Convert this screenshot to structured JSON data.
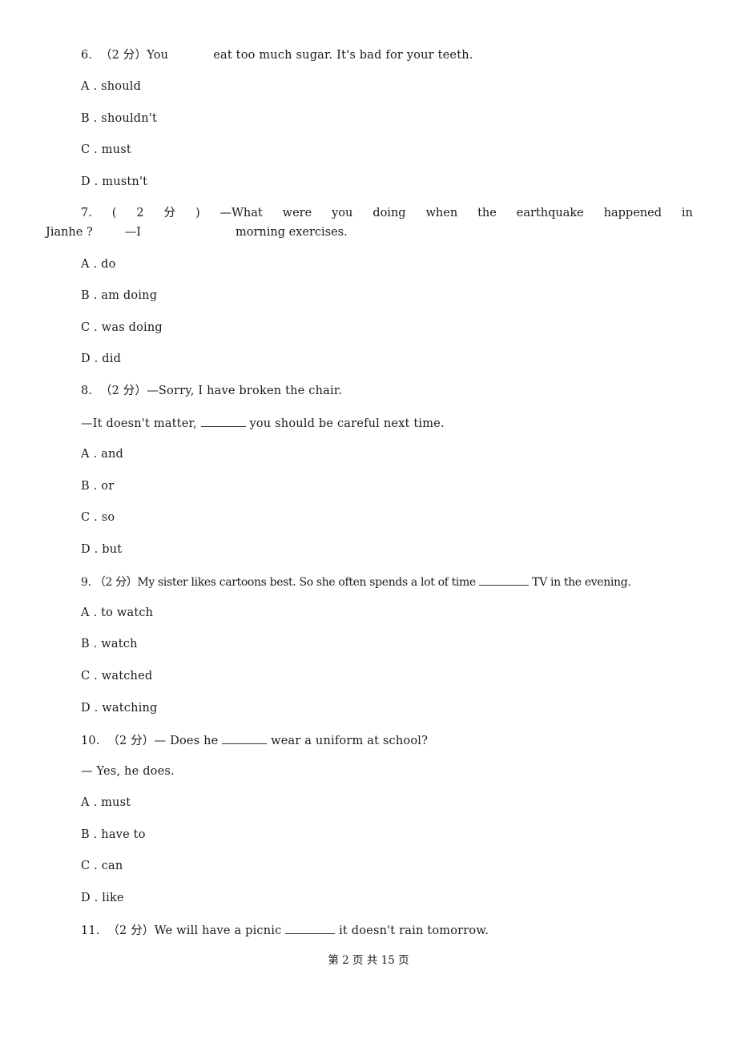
{
  "page": {
    "footer": "第 2 页 共 15 页"
  },
  "questions": [
    {
      "number": "6.",
      "score": "（2 分）",
      "stem_parts": [
        "You",
        "eat too much sugar. It's bad for your teeth."
      ],
      "options": [
        {
          "letter": "A .",
          "text": "should"
        },
        {
          "letter": "B .",
          "text": "shouldn't"
        },
        {
          "letter": "C .",
          "text": "must"
        },
        {
          "letter": "D .",
          "text": "mustn't"
        }
      ]
    },
    {
      "number": "7.",
      "score_parts": [
        "(",
        "2",
        "分",
        ")"
      ],
      "stem_line1_words": [
        "—What",
        "were",
        "you",
        "doing",
        "when",
        "the",
        "earthquake",
        "happened",
        "in"
      ],
      "stem_line2_parts": [
        "Jianhe ?",
        "—I",
        "morning exercises."
      ],
      "options": [
        {
          "letter": "A .",
          "text": "do"
        },
        {
          "letter": "B .",
          "text": "am doing"
        },
        {
          "letter": "C .",
          "text": "was doing"
        },
        {
          "letter": "D .",
          "text": "did"
        }
      ]
    },
    {
      "number": "8.",
      "score": "（2 分）",
      "stem_line1": "—Sorry, I have broken the chair.",
      "stem_line2_parts": [
        "—It doesn't matter,",
        "you should be careful next time."
      ],
      "options": [
        {
          "letter": "A .",
          "text": "and"
        },
        {
          "letter": "B .",
          "text": "or"
        },
        {
          "letter": "C .",
          "text": "so"
        },
        {
          "letter": "D .",
          "text": "but"
        }
      ]
    },
    {
      "number": "9.",
      "score": "（2 分）",
      "stem_parts": [
        "My sister likes cartoons best. So she often spends a lot of time",
        "TV in the evening."
      ],
      "options": [
        {
          "letter": "A .",
          "text": "to watch"
        },
        {
          "letter": "B .",
          "text": "watch"
        },
        {
          "letter": "C .",
          "text": "watched"
        },
        {
          "letter": "D .",
          "text": "watching"
        }
      ]
    },
    {
      "number": "10.",
      "score": "（2 分）",
      "stem_line1_parts": [
        "— Does he",
        "wear a uniform at school?"
      ],
      "stem_line2": "— Yes, he does.",
      "options": [
        {
          "letter": "A .",
          "text": "must"
        },
        {
          "letter": "B .",
          "text": "have to"
        },
        {
          "letter": "C .",
          "text": "can"
        },
        {
          "letter": "D .",
          "text": "like"
        }
      ]
    },
    {
      "number": "11.",
      "score": "（2 分）",
      "stem_parts": [
        "We will have a picnic",
        "it doesn't rain tomorrow."
      ]
    }
  ]
}
